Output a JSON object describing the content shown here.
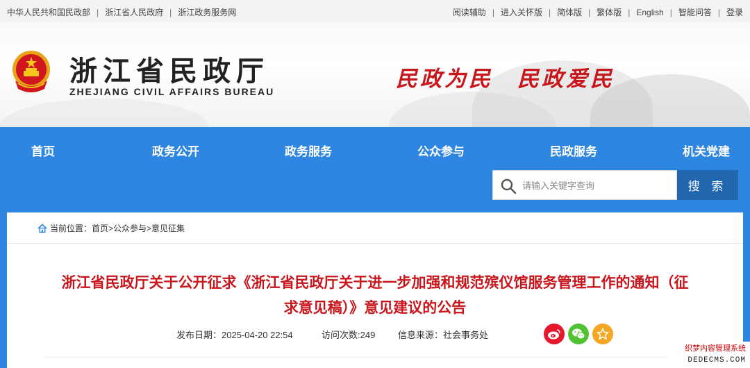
{
  "topbar": {
    "left_links": [
      "中华人民共和国民政部",
      "浙江省人民政府",
      "浙江政务服务网"
    ],
    "right_links": [
      "阅读辅助",
      "进入关怀版",
      "简体版",
      "繁体版",
      "English",
      "智能问答",
      "登录"
    ]
  },
  "header": {
    "title": "浙江省民政厅",
    "subtitle": "ZHEJIANG CIVIL AFFAIRS BUREAU",
    "slogan": "民政为民　民政爱民"
  },
  "nav": {
    "items": [
      "首页",
      "政务公开",
      "政务服务",
      "公众参与",
      "民政服务",
      "机关党建"
    ]
  },
  "search": {
    "placeholder": "请输入关键字查询",
    "button_label": "搜 索"
  },
  "breadcrumb": {
    "text": "当前位置：首页>公众参与>意见征集"
  },
  "article": {
    "title_line1": "浙江省民政厅关于公开征求《浙江省民政厅关于进一步加强和规范殡仪馆服务管理工作的通知（征",
    "title_line2": "求意见稿）》意见建议的公告",
    "publish_date": "发布日期：2025-04-20 22:54",
    "visits": "访问次数:249",
    "source": "信息来源：社会事务处"
  },
  "share_icons": [
    "weibo-icon",
    "wechat-icon",
    "favorite-icon"
  ],
  "watermark": {
    "line1": "织梦内容管理系统",
    "line2": "DEDECMS.COM"
  },
  "colors": {
    "nav_blue": "#2f86e0",
    "search_button": "#2266b0",
    "title_red": "#c8161d",
    "weibo": "#e6162d",
    "wechat": "#51c332",
    "favorite": "#f5a623"
  }
}
